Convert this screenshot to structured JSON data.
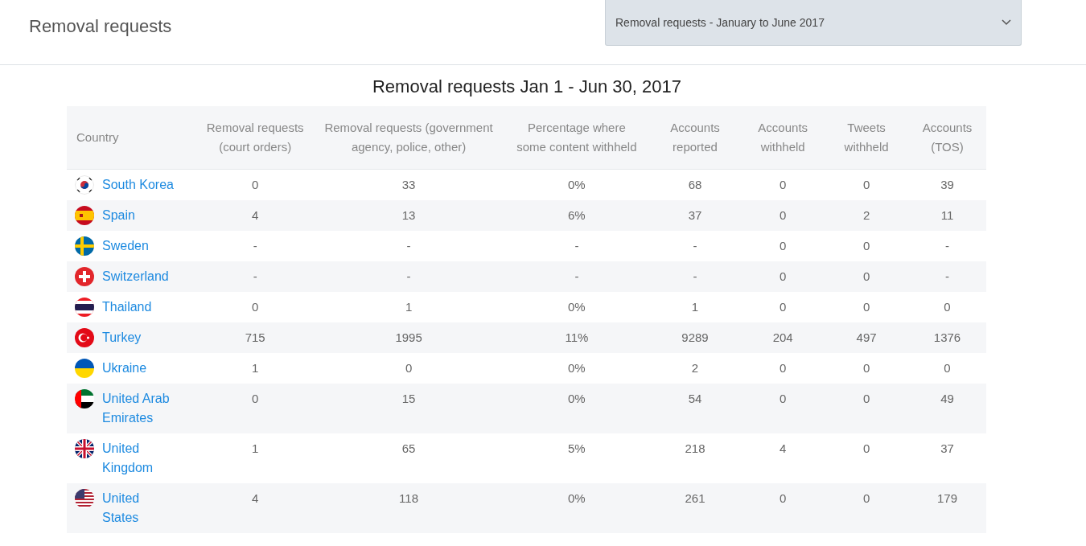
{
  "header": {
    "title": "Removal requests",
    "period_select": {
      "value": "Removal requests - January to June 2017"
    }
  },
  "table": {
    "title": "Removal requests Jan 1 - Jun 30, 2017",
    "columns": [
      "Country",
      "Removal requests (court orders)",
      "Removal requests (government agency, police, other)",
      "Percentage where some content withheld",
      "Accounts reported",
      "Accounts withheld",
      "Tweets withheld",
      "Accounts (TOS)"
    ],
    "rows": [
      {
        "country": "South Korea",
        "kind": "kr",
        "values": [
          "0",
          "33",
          "0%",
          "68",
          "0",
          "0",
          "39"
        ]
      },
      {
        "country": "Spain",
        "kind": "es",
        "values": [
          "4",
          "13",
          "6%",
          "37",
          "0",
          "2",
          "11"
        ]
      },
      {
        "country": "Sweden",
        "kind": "se",
        "values": [
          "-",
          "-",
          "-",
          "-",
          "0",
          "0",
          "-"
        ]
      },
      {
        "country": "Switzerland",
        "kind": "ch",
        "values": [
          "-",
          "-",
          "-",
          "-",
          "0",
          "0",
          "-"
        ]
      },
      {
        "country": "Thailand",
        "kind": "th",
        "values": [
          "0",
          "1",
          "0%",
          "1",
          "0",
          "0",
          "0"
        ]
      },
      {
        "country": "Turkey",
        "kind": "tr",
        "values": [
          "715",
          "1995",
          "11%",
          "9289",
          "204",
          "497",
          "1376"
        ]
      },
      {
        "country": "Ukraine",
        "kind": "ua",
        "values": [
          "1",
          "0",
          "0%",
          "2",
          "0",
          "0",
          "0"
        ]
      },
      {
        "country": "United Arab Emirates",
        "kind": "ae",
        "values": [
          "0",
          "15",
          "0%",
          "54",
          "0",
          "0",
          "49"
        ]
      },
      {
        "country": "United Kingdom",
        "kind": "gb",
        "values": [
          "1",
          "65",
          "5%",
          "218",
          "4",
          "0",
          "37"
        ]
      },
      {
        "country": "United States",
        "kind": "us",
        "values": [
          "4",
          "118",
          "0%",
          "261",
          "0",
          "0",
          "179"
        ]
      }
    ]
  }
}
